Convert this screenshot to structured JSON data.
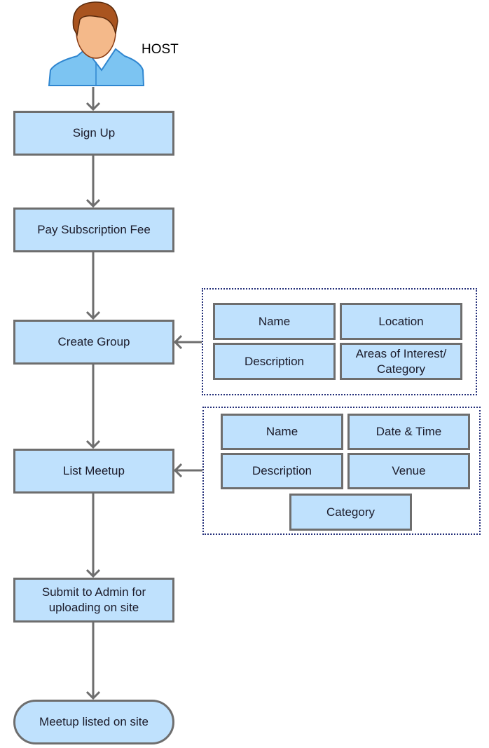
{
  "actor": {
    "label": "HOST",
    "icon": "person-icon"
  },
  "flow": [
    {
      "id": "sign-up",
      "label": "Sign Up"
    },
    {
      "id": "pay-subscription-fee",
      "label": "Pay Subscription Fee"
    },
    {
      "id": "create-group",
      "label": "Create Group"
    },
    {
      "id": "list-meetup",
      "label": "List Meetup"
    },
    {
      "id": "submit-to-admin",
      "label": "Submit to Admin for uploading on site"
    },
    {
      "id": "meetup-listed",
      "label": "Meetup listed on site"
    }
  ],
  "group_fields": [
    "Name",
    "Location",
    "Description",
    "Areas of Interest/ Category"
  ],
  "meetup_fields": [
    "Name",
    "Date & Time",
    "Description",
    "Venue",
    "Category"
  ],
  "colors": {
    "box_fill": "#bfe1fd",
    "box_border": "#6e6e6e",
    "arrow": "#6e6e6e",
    "group_border": "#25307a"
  }
}
